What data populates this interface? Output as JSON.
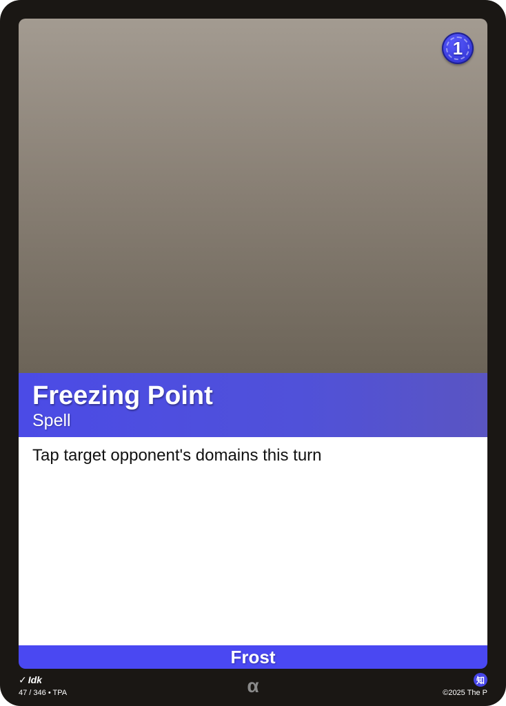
{
  "card": {
    "name": "Freezing Point",
    "type": "Spell",
    "cost": "1",
    "rules_text": "Tap target opponent's domains this turn",
    "element": "Frost",
    "element_color": "#4a48f2",
    "title_bar_color": "#4b4be6"
  },
  "footer": {
    "artist_icon": "brush-icon",
    "artist": "Idk",
    "set_info": "47 / 346 • TPA",
    "rarity_symbol": "α",
    "badge_glyph": "知",
    "copyright": "©2025 The P"
  }
}
